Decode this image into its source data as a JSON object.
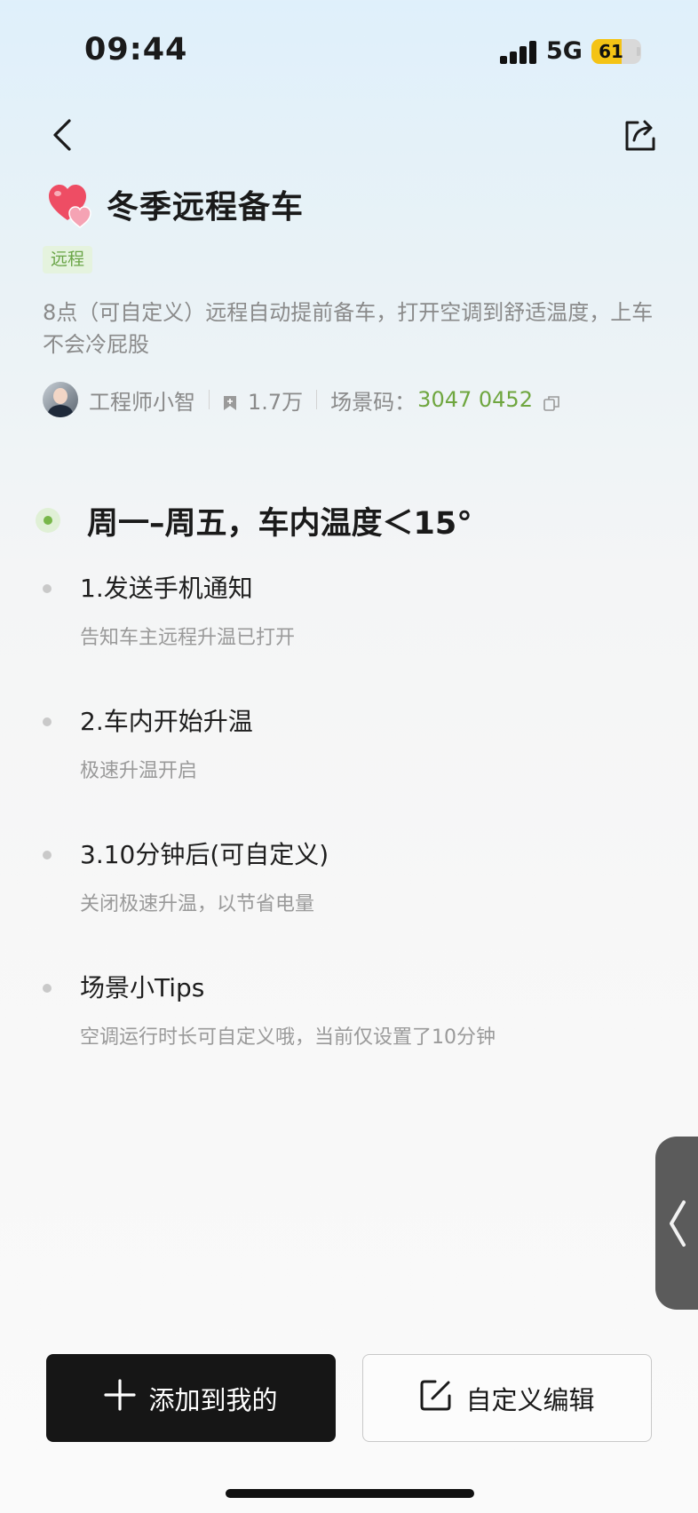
{
  "status_bar": {
    "time": "09:44",
    "network": "5G",
    "battery_level": "61",
    "battery_color": "#f4c315"
  },
  "nav": {
    "back_icon": "chevron-left-icon",
    "share_icon": "share-icon"
  },
  "scene": {
    "icon": "heart-icon",
    "title": "冬季远程备车",
    "tag": "远程",
    "description": "8点（可自定义）远程自动提前备车，打开空调到舒适温度，上车不会冷屁股",
    "author": "工程师小智",
    "bookmarks": "1.7万",
    "code_label": "场景码：",
    "code_value": "3047 0452"
  },
  "trigger": {
    "title": "周一–周五，车内温度＜15°"
  },
  "steps": [
    {
      "title": "1.发送手机通知",
      "desc": "告知车主远程升温已打开"
    },
    {
      "title": "2.车内开始升温",
      "desc": "极速升温开启"
    },
    {
      "title": "3.10分钟后(可自定义)",
      "desc": "关闭极速升温，以节省电量"
    },
    {
      "title": "场景小Tips",
      "desc": "空调运行时长可自定义哦，当前仅设置了10分钟"
    }
  ],
  "actions": {
    "add_label": "添加到我的",
    "edit_label": "自定义编辑"
  },
  "colors": {
    "accent_green": "#6fa63f",
    "tag_bg": "#e5f3de",
    "primary_button": "#161616"
  }
}
